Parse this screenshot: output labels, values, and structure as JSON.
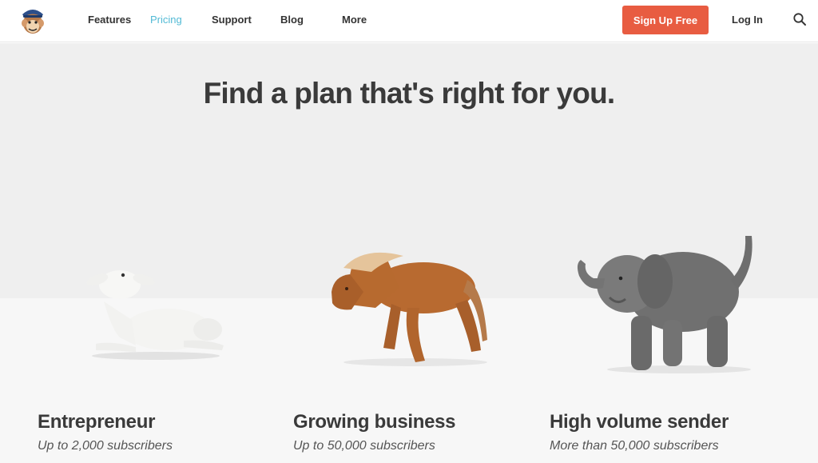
{
  "nav": {
    "logo": "freddie-logo-icon",
    "items": [
      {
        "label": "Features",
        "active": false
      },
      {
        "label": "Pricing",
        "active": true
      },
      {
        "label": "Support",
        "active": false
      },
      {
        "label": "Blog",
        "active": false
      },
      {
        "label": "More",
        "active": false
      }
    ],
    "signup_label": "Sign Up Free",
    "login_label": "Log In",
    "search_icon": "search-icon"
  },
  "hero": {
    "title": "Find a plan that's right for you."
  },
  "plans": [
    {
      "name": "Entrepreneur",
      "subtitle": "Up to 2,000 subscribers",
      "image": "lamb-figurine"
    },
    {
      "name": "Growing business",
      "subtitle": "Up to 50,000 subscribers",
      "image": "horse-figurine"
    },
    {
      "name": "High volume sender",
      "subtitle": "More than 50,000 subscribers",
      "image": "elephant-figurine"
    }
  ],
  "colors": {
    "accent": "#52bad5",
    "signup": "#e85c41",
    "background_top": "#efefef",
    "background_bottom": "#f7f7f7"
  }
}
